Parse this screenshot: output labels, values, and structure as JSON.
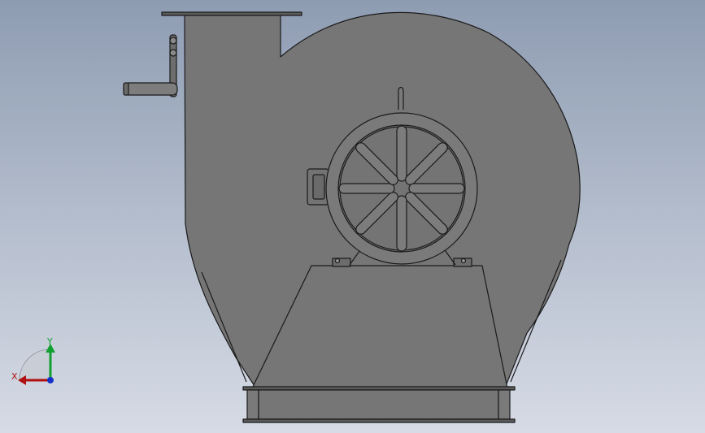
{
  "view": {
    "model": "centrifugal-fan-assembly",
    "orientation": "front"
  },
  "colors": {
    "background_top": "#8e9cb2",
    "background_bottom": "#d6dbe5",
    "body": "#767676",
    "edge": "#1a1a1a",
    "axis_x": "#b01010",
    "axis_y": "#10a030",
    "axis_z": "#1530c8"
  },
  "triad": {
    "x_label": "X",
    "y_label": "Y"
  },
  "icons": {
    "triad": "coordinate-triad-icon"
  }
}
